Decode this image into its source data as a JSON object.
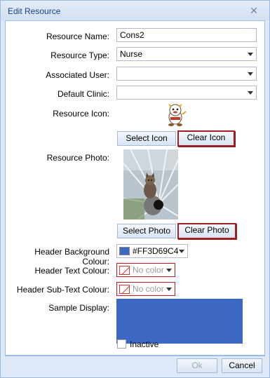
{
  "window": {
    "title": "Edit Resource"
  },
  "form": {
    "resource_name": {
      "label": "Resource Name:",
      "value": "Cons2"
    },
    "resource_type": {
      "label": "Resource Type:",
      "value": "Nurse"
    },
    "associated_user": {
      "label": "Associated User:",
      "value": ""
    },
    "default_clinic": {
      "label": "Default Clinic:",
      "value": ""
    },
    "resource_icon": {
      "label": "Resource Icon:",
      "select_label": "Select Icon",
      "clear_label": "Clear Icon"
    },
    "resource_photo": {
      "label": "Resource Photo:",
      "select_label": "Select Photo",
      "clear_label": "Clear Photo"
    },
    "header_bg_colour": {
      "label": "Header Background Colour:",
      "value": "#FF3D69C4",
      "swatch": "#3D69C4"
    },
    "header_text_colour": {
      "label": "Header Text Colour:",
      "value": "No color"
    },
    "header_subtext_colour": {
      "label": "Header Sub-Text Colour:",
      "value": "No color"
    },
    "sample_display": {
      "label": "Sample Display:",
      "color": "#3D69C4"
    },
    "inactive": {
      "label": "Inactive",
      "checked": false
    }
  },
  "footer": {
    "ok_label": "Ok",
    "cancel_label": "Cancel"
  },
  "icons": {
    "close": "close-icon",
    "resource_icon": "cartoon-character-icon",
    "photo": "kitten-photo"
  }
}
